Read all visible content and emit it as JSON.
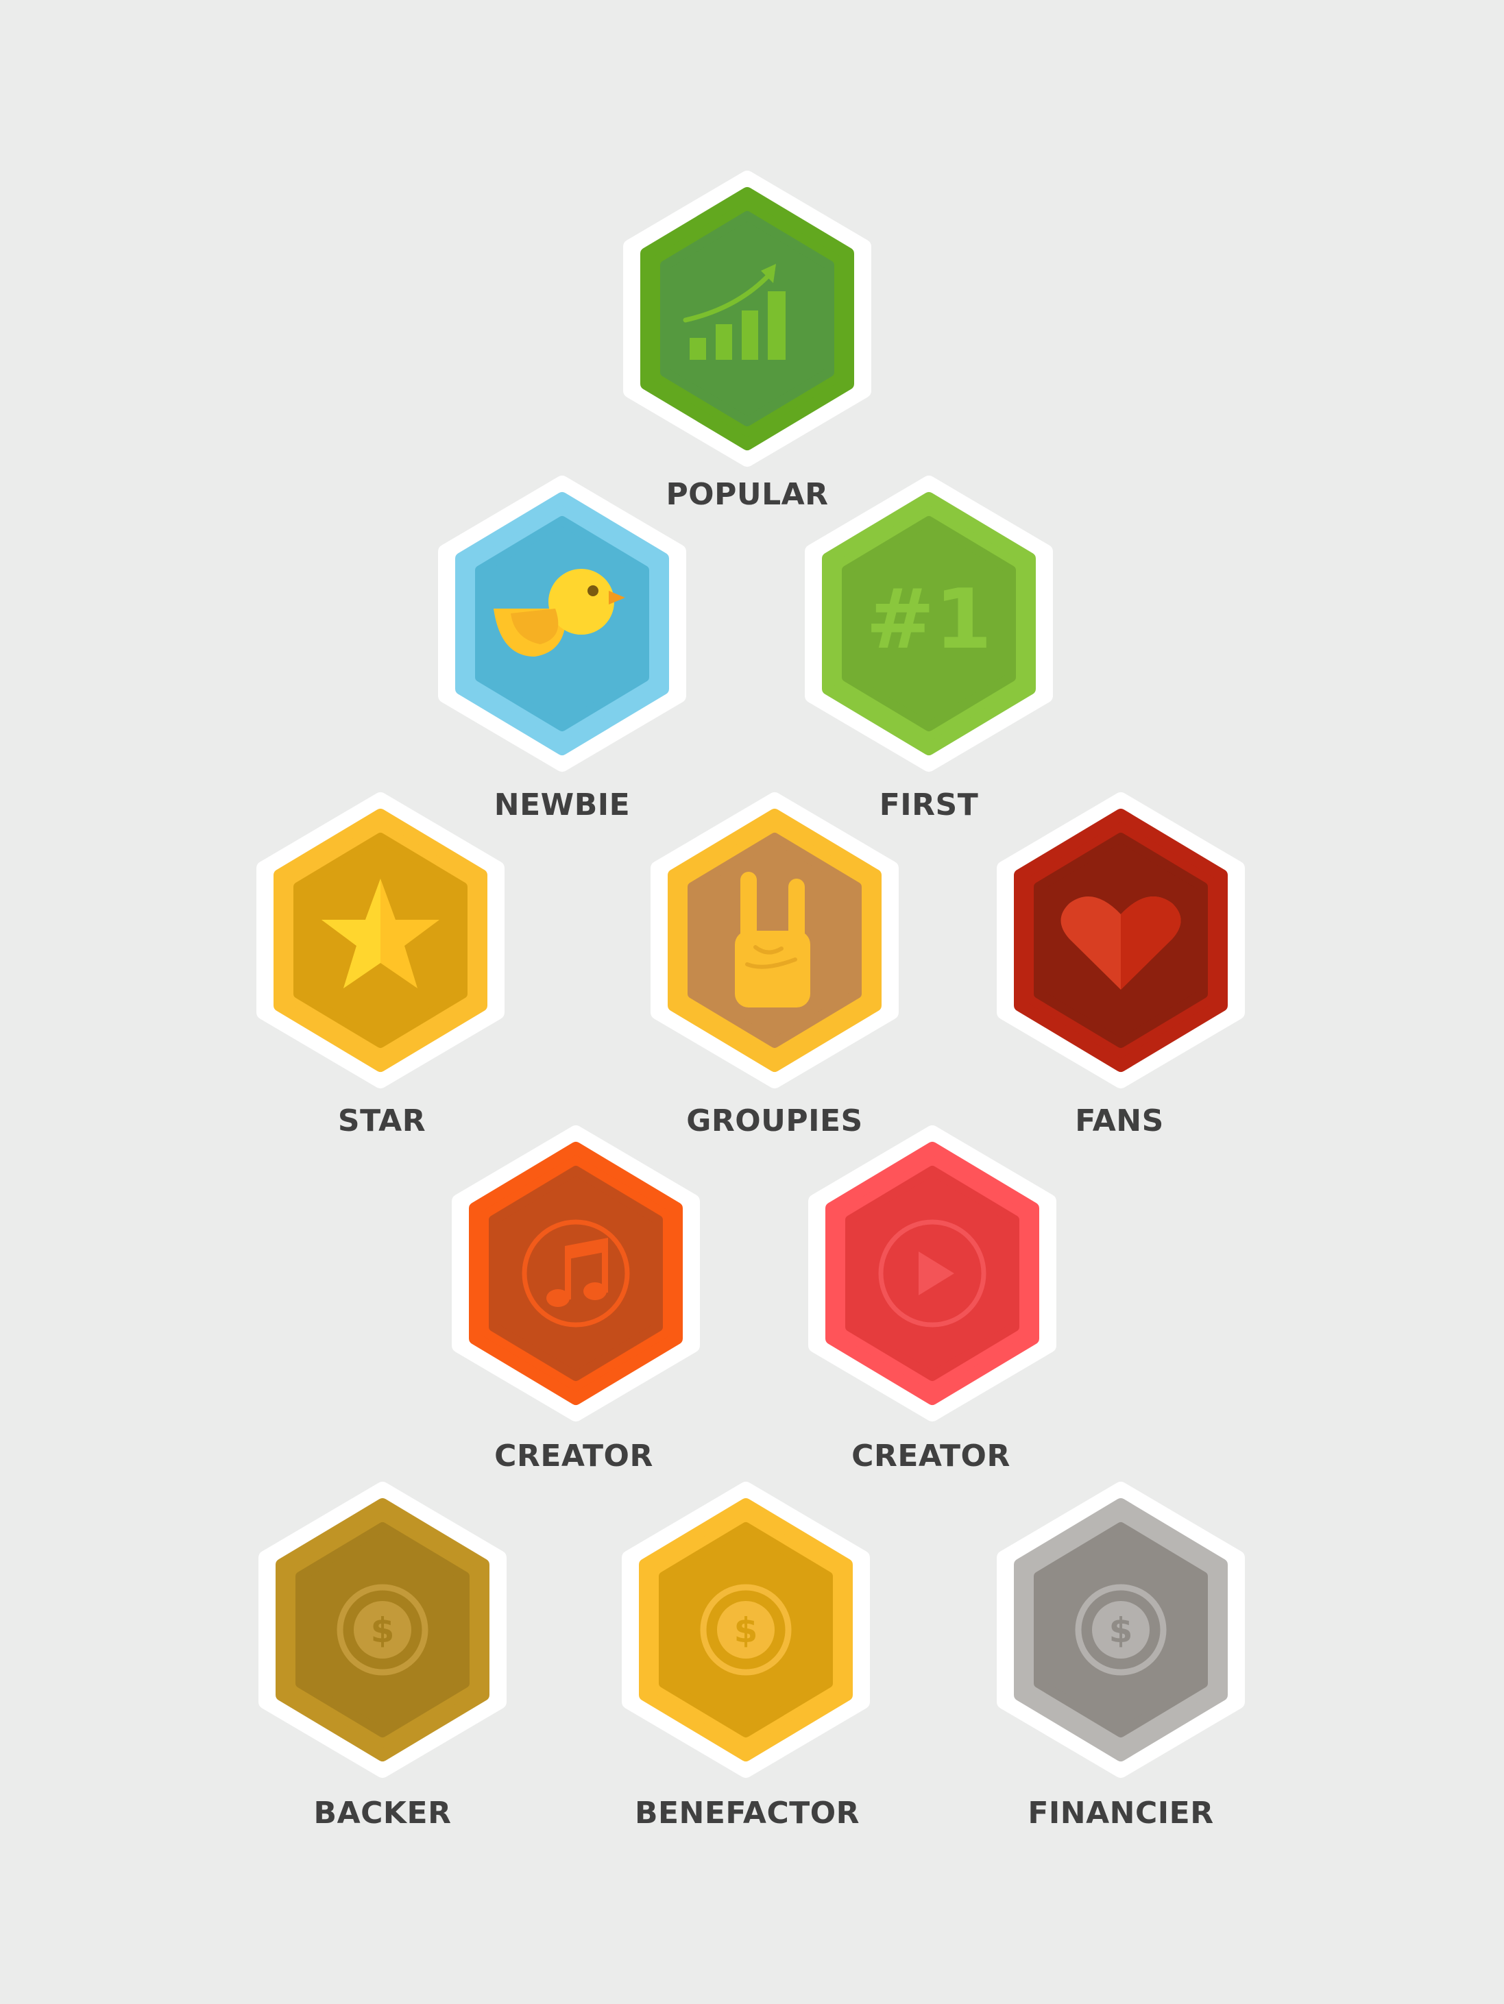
{
  "background": "#EBECEB",
  "label_color": "#404040",
  "badges": [
    {
      "id": "popular",
      "label": "POPULAR",
      "icon": "bar-chart-trend-icon",
      "colors": {
        "outer": "#62A81F",
        "inner": "#55993F",
        "icon": "#7BBF2E"
      }
    },
    {
      "id": "newbie",
      "label": "NEWBIE",
      "icon": "bird-icon",
      "colors": {
        "outer": "#7FD0EC",
        "inner": "#52B5D4",
        "icon": "#FFC327"
      }
    },
    {
      "id": "first",
      "label": "FIRST",
      "icon": "number-one-icon",
      "colors": {
        "outer": "#8AC73D",
        "inner": "#74AE32",
        "icon": "#8AC73D"
      }
    },
    {
      "id": "star",
      "label": "STAR",
      "icon": "star-icon",
      "colors": {
        "outer": "#FBBE2E",
        "inner": "#DAA011",
        "icon": "#FFC327"
      }
    },
    {
      "id": "groupies",
      "label": "GROUPIES",
      "icon": "rock-hand-icon",
      "colors": {
        "outer": "#FBBE2E",
        "inner": "#C58A4C",
        "icon": "#FBBE2E"
      }
    },
    {
      "id": "fans",
      "label": "FANS",
      "icon": "heart-icon",
      "colors": {
        "outer": "#BA2411",
        "inner": "#8D200E",
        "icon": "#D83E22"
      }
    },
    {
      "id": "creator-music",
      "label": "CREATOR",
      "icon": "music-note-icon",
      "colors": {
        "outer": "#FA5B13",
        "inner": "#C44D1A",
        "icon": "#F25B1A"
      }
    },
    {
      "id": "creator-video",
      "label": "CREATOR",
      "icon": "play-button-icon",
      "colors": {
        "outer": "#FF5459",
        "inner": "#E53C3D",
        "icon": "#F35457"
      }
    },
    {
      "id": "backer",
      "label": "BACKER",
      "icon": "dollar-coin-icon",
      "colors": {
        "outer": "#C09425",
        "inner": "#A7801E",
        "icon": "#C39A3A"
      }
    },
    {
      "id": "benefactor",
      "label": "BENEFACTOR",
      "icon": "dollar-coin-icon",
      "colors": {
        "outer": "#FBBE2E",
        "inner": "#DAA011",
        "icon": "#F4BA3A"
      }
    },
    {
      "id": "financier",
      "label": "FINANCIER",
      "icon": "dollar-coin-icon",
      "colors": {
        "outer": "#B8B6B3",
        "inner": "#908C87",
        "icon": "#B4B1AE"
      }
    }
  ]
}
